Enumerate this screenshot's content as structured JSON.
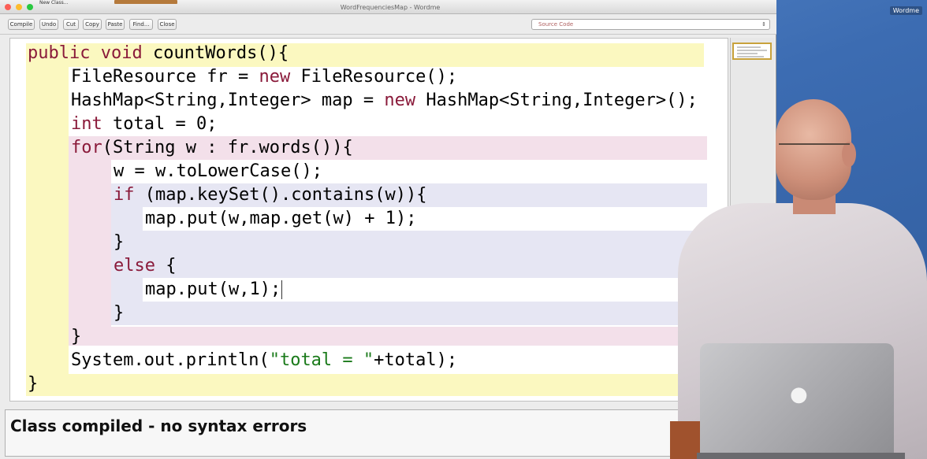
{
  "window": {
    "title": "WordFrequenciesMap - Wordme",
    "tab_label": "New Class..."
  },
  "desktop": {
    "corner_label": "Wordme"
  },
  "toolbar": {
    "compile": "Compile",
    "undo": "Undo",
    "cut": "Cut",
    "copy": "Copy",
    "paste": "Paste",
    "find": "Find...",
    "close": "Close",
    "view_select": "Source Code"
  },
  "editor": {
    "lines": [
      "public void countWords(){",
      "FileResource fr = new FileResource();",
      "HashMap<String,Integer> map = new HashMap<String,Integer>();",
      "int total = 0;",
      "for(String w : fr.words()){",
      "w = w.toLowerCase();",
      "if (map.keySet().contains(w)){",
      "map.put(w,map.get(w) + 1);",
      "}",
      "else {",
      "map.put(w,1);",
      "}",
      "}",
      "System.out.println(\"total = \"+total);",
      "}"
    ]
  },
  "status": {
    "message": "Class compiled - no syntax errors"
  },
  "colors": {
    "keyword": "#8a1a3a",
    "string": "#1a7a1a",
    "method_scope": "#fbf8c0",
    "loop_scope": "#f3e0ea",
    "if_scope": "#e6e6f3"
  },
  "icons": {
    "window_close": "close-dot",
    "window_minimize": "minimize-dot",
    "window_zoom": "zoom-dot",
    "dropdown": "chevron-down-icon",
    "laptop_logo": "apple-logo-icon"
  }
}
